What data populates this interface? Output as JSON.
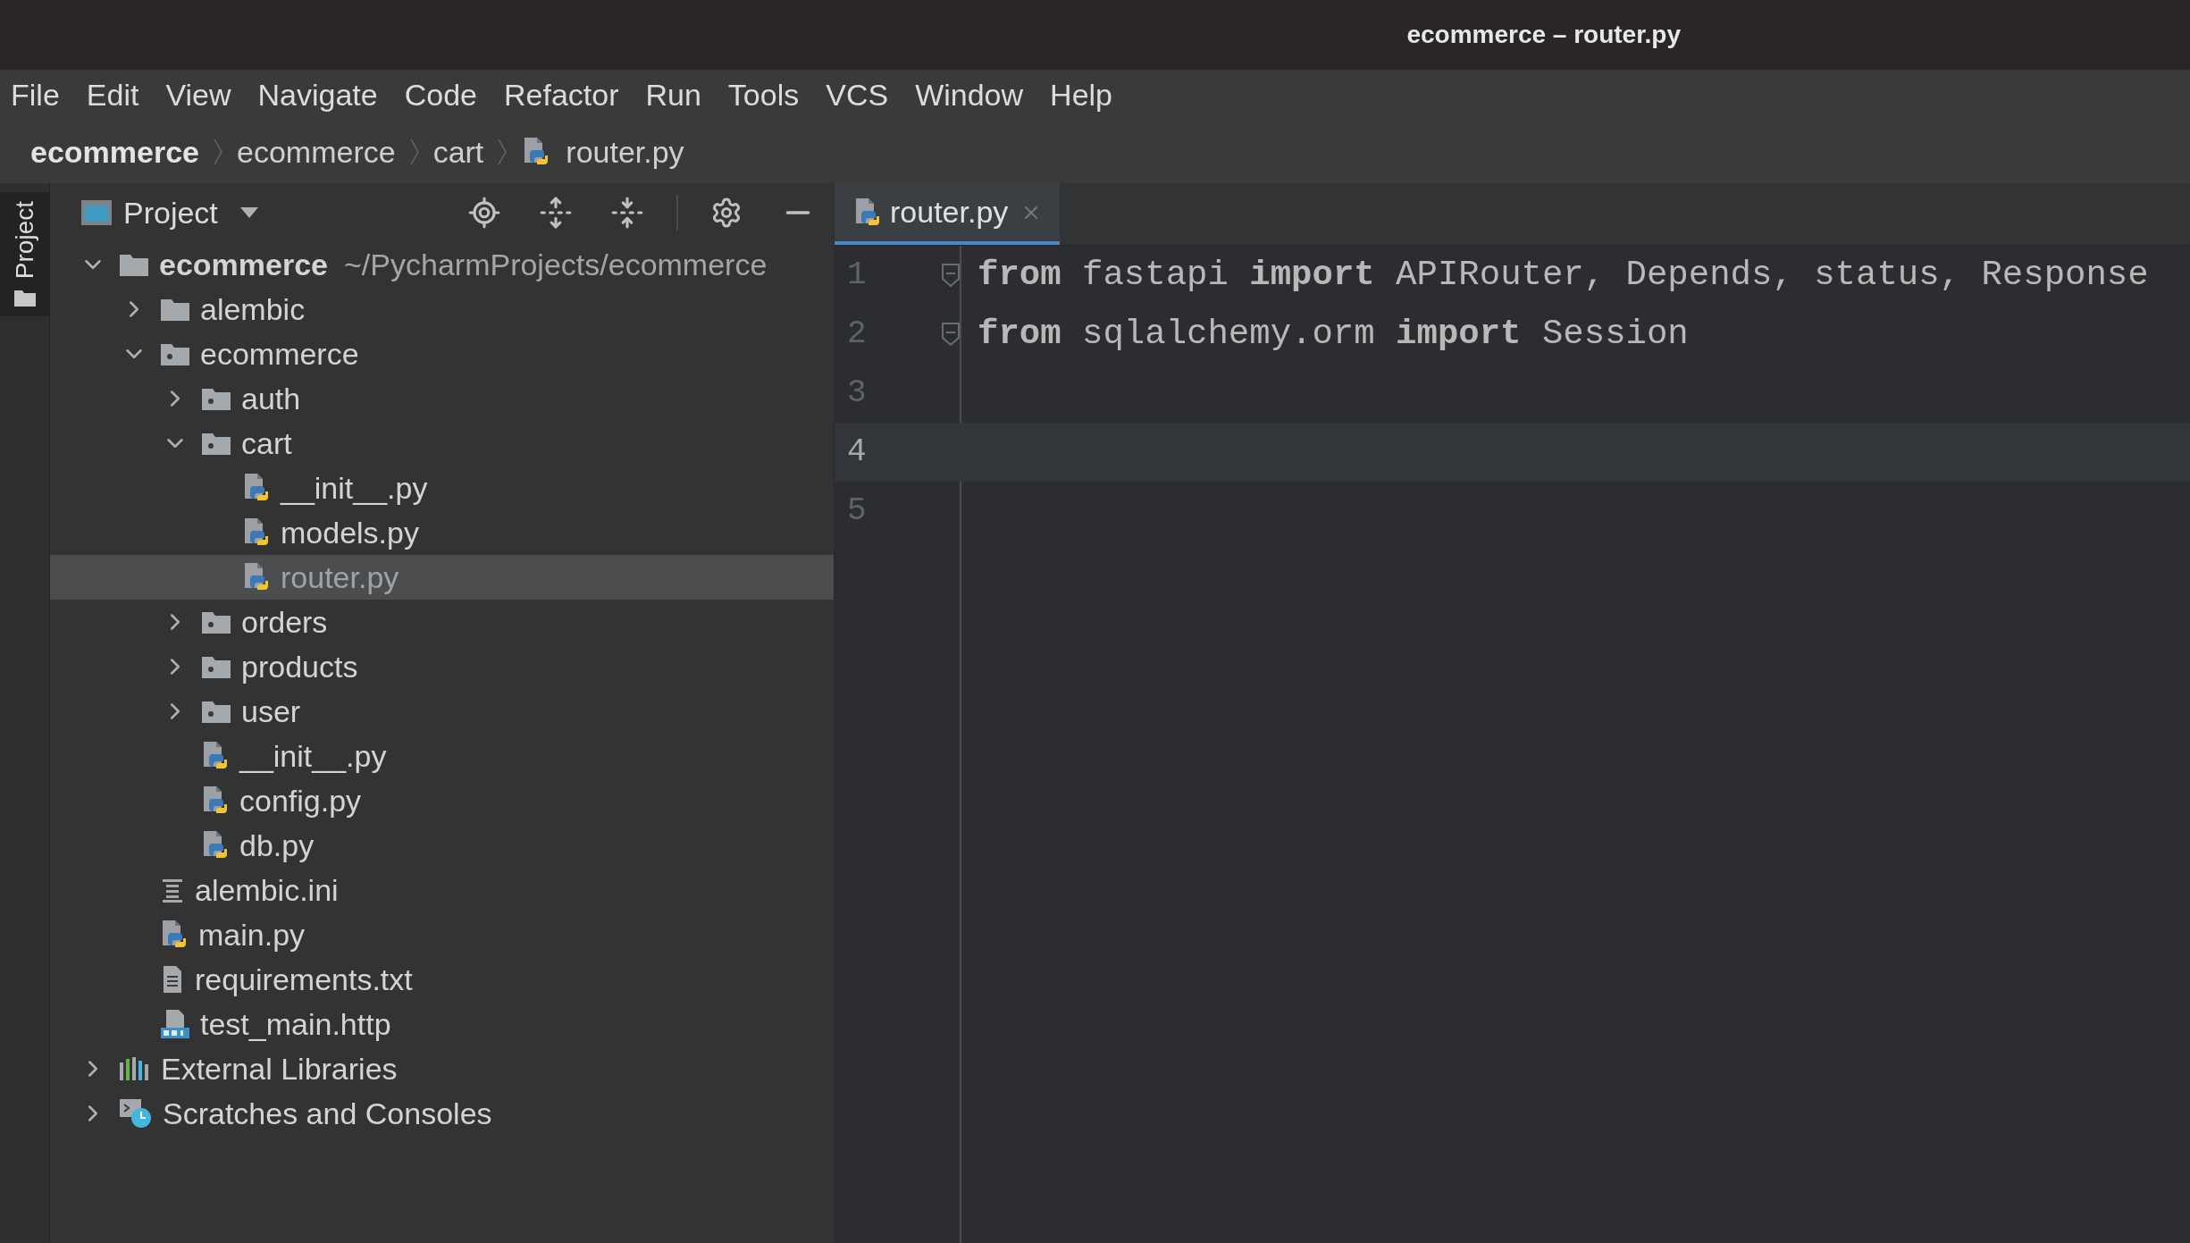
{
  "window": {
    "title": "ecommerce – router.py"
  },
  "menu": [
    "File",
    "Edit",
    "View",
    "Navigate",
    "Code",
    "Refactor",
    "Run",
    "Tools",
    "VCS",
    "Window",
    "Help"
  ],
  "breadcrumb": [
    {
      "label": "ecommerce",
      "kind": "project"
    },
    {
      "label": "ecommerce",
      "kind": "folder"
    },
    {
      "label": "cart",
      "kind": "folder"
    },
    {
      "label": "router.py",
      "kind": "python"
    }
  ],
  "side_stripe": {
    "label": "Project"
  },
  "project_panel": {
    "title": "Project",
    "tree": [
      {
        "label": "ecommerce",
        "hint": "~/PycharmProjects/ecommerce",
        "kind": "folder",
        "expanded": true,
        "selected": false,
        "children": [
          {
            "label": "alembic",
            "kind": "folder",
            "expanded": false,
            "selected": false
          },
          {
            "label": "ecommerce",
            "kind": "package",
            "expanded": true,
            "selected": false,
            "children": [
              {
                "label": "auth",
                "kind": "package",
                "expanded": false,
                "selected": false
              },
              {
                "label": "cart",
                "kind": "package",
                "expanded": true,
                "selected": false,
                "children": [
                  {
                    "label": "__init__.py",
                    "kind": "python",
                    "selected": false
                  },
                  {
                    "label": "models.py",
                    "kind": "python",
                    "selected": false
                  },
                  {
                    "label": "router.py",
                    "kind": "python",
                    "selected": true
                  }
                ]
              },
              {
                "label": "orders",
                "kind": "package",
                "expanded": false,
                "selected": false
              },
              {
                "label": "products",
                "kind": "package",
                "expanded": false,
                "selected": false
              },
              {
                "label": "user",
                "kind": "package",
                "expanded": false,
                "selected": false
              },
              {
                "label": "__init__.py",
                "kind": "python",
                "selected": false
              },
              {
                "label": "config.py",
                "kind": "python",
                "selected": false
              },
              {
                "label": "db.py",
                "kind": "python",
                "selected": false
              }
            ]
          },
          {
            "label": "alembic.ini",
            "kind": "ini",
            "selected": false
          },
          {
            "label": "main.py",
            "kind": "python",
            "selected": false
          },
          {
            "label": "requirements.txt",
            "kind": "text",
            "selected": false
          },
          {
            "label": "test_main.http",
            "kind": "http",
            "selected": false
          }
        ]
      },
      {
        "label": "External Libraries",
        "kind": "libraries",
        "expanded": false,
        "selected": false
      },
      {
        "label": "Scratches and Consoles",
        "kind": "scratches",
        "expanded": false,
        "selected": false
      }
    ]
  },
  "tabs": [
    {
      "label": "router.py",
      "selected": true
    }
  ],
  "editor": {
    "lines": [
      {
        "number": "1",
        "code": "**from** fastapi **import** APIRouter, Depends, status, Response",
        "fold": true,
        "current": false
      },
      {
        "number": "2",
        "code": "**from** sqlalchemy.orm **import** Session",
        "fold": true,
        "current": false
      },
      {
        "number": "3",
        "current": false
      },
      {
        "number": "4",
        "current": true
      },
      {
        "number": "5",
        "current": false
      }
    ]
  }
}
